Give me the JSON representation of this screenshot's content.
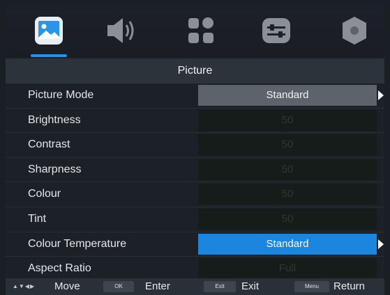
{
  "tabs": [
    {
      "name": "picture",
      "icon": "picture-icon",
      "active": true
    },
    {
      "name": "sound",
      "icon": "speaker-icon",
      "active": false
    },
    {
      "name": "channel",
      "icon": "apps-icon",
      "active": false
    },
    {
      "name": "settings",
      "icon": "sliders-icon",
      "active": false
    },
    {
      "name": "lock",
      "icon": "disc-icon",
      "active": false
    }
  ],
  "header": {
    "title": "Picture"
  },
  "menu": {
    "items": [
      {
        "label": "Picture Mode",
        "value": "Standard",
        "state": "selected-grey"
      },
      {
        "label": "Brightness",
        "value": "50",
        "state": "disabled"
      },
      {
        "label": "Contrast",
        "value": "50",
        "state": "disabled"
      },
      {
        "label": "Sharpness",
        "value": "50",
        "state": "disabled"
      },
      {
        "label": "Colour",
        "value": "50",
        "state": "disabled"
      },
      {
        "label": "Tint",
        "value": "50",
        "state": "disabled"
      },
      {
        "label": "Colour Temperature",
        "value": "Standard",
        "state": "focused"
      },
      {
        "label": "Aspect Ratio",
        "value": "Full",
        "state": "disabled"
      }
    ]
  },
  "footer": {
    "move_label": "Move",
    "ok_key": "OK",
    "enter_label": "Enter",
    "exit_key": "Exit",
    "exit_label": "Exit",
    "menu_key": "Menu",
    "return_label": "Return"
  },
  "colors": {
    "accent": "#1c86de",
    "background": "#1a1e25",
    "header": "#2d333a"
  }
}
